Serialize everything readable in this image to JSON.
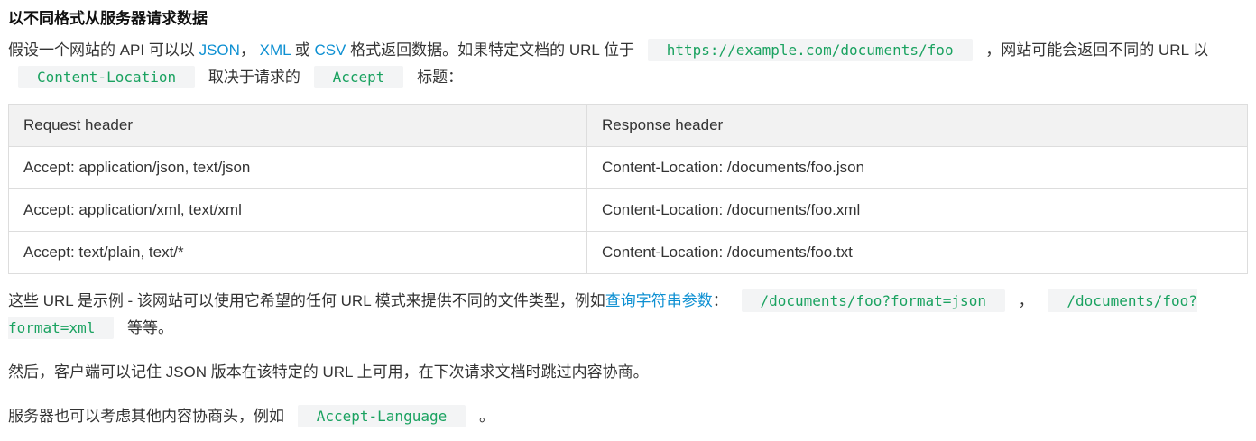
{
  "section": {
    "title": "以不同格式从服务器请求数据"
  },
  "intro": {
    "t1": "假设一个网站的 API 可以以 ",
    "link_json": "JSON",
    "t2": "， ",
    "link_xml": "XML",
    "t3": " 或 ",
    "link_csv": "CSV",
    "t4": " 格式返回数据。如果特定文档的 URL 位于 ",
    "code_url": "https://example.com/documents/foo",
    "t5": " ，网站可能会返回不同的 URL 以 ",
    "code_content_location": "Content-Location",
    "t6": " 取决于请求的 ",
    "code_accept": "Accept",
    "t7": " 标题："
  },
  "table": {
    "headers": [
      "Request header",
      "Response header"
    ],
    "rows": [
      [
        "Accept: application/json, text/json",
        "Content-Location: /documents/foo.json"
      ],
      [
        "Accept: application/xml, text/xml",
        "Content-Location: /documents/foo.xml"
      ],
      [
        "Accept: text/plain, text/*",
        "Content-Location: /documents/foo.txt"
      ]
    ]
  },
  "examples": {
    "t1": "这些 URL 是示例 - 该网站可以使用它希望的任何 URL 模式来提供不同的文件类型，例如",
    "link_query": "查询字符串参数",
    "t2": "： ",
    "code_json": "/documents/foo?format=json",
    "t3": " ， ",
    "code_xml": "/documents/foo?format=xml",
    "t4": " 等等。"
  },
  "remember": {
    "text": "然后，客户端可以记住 JSON 版本在该特定的 URL 上可用，在下次请求文档时跳过内容协商。"
  },
  "other_headers": {
    "t1": "服务器也可以考虑其他内容协商头，例如 ",
    "code_lang": "Accept-Language",
    "t2": " 。"
  },
  "colors": {
    "link": "#0e90d2",
    "code_text": "#1aa260",
    "code_bg": "#f3f4f5",
    "table_header_bg": "#f2f2f2",
    "border": "#dddddd"
  }
}
